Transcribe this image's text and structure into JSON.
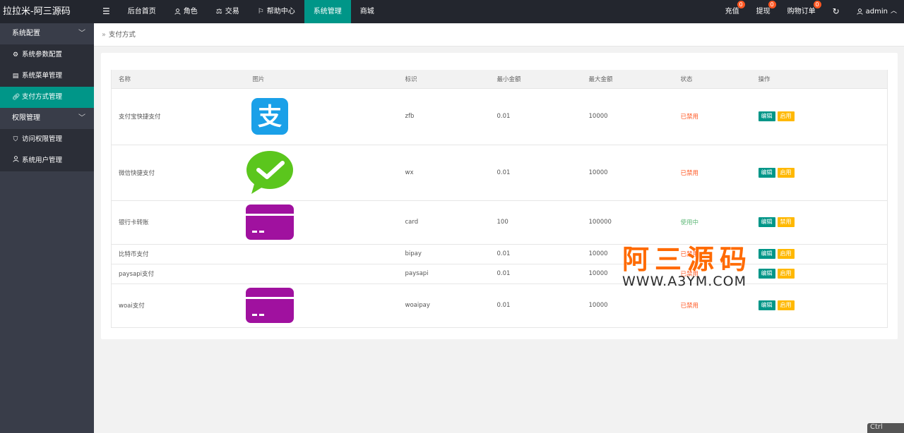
{
  "app": {
    "title": "拉拉米-阿三源码"
  },
  "nav": {
    "toggle_icon": "menu-icon",
    "items": [
      {
        "label": "后台首页",
        "icon": ""
      },
      {
        "label": "角色",
        "icon": "user-icon"
      },
      {
        "label": "交易",
        "icon": "scale-icon"
      },
      {
        "label": "帮助中心",
        "icon": "flag-icon"
      },
      {
        "label": "系统管理",
        "icon": "",
        "active": true
      },
      {
        "label": "商城",
        "icon": ""
      }
    ],
    "right": {
      "recharge": {
        "label": "充值",
        "badge": "0"
      },
      "withdraw": {
        "label": "提现",
        "badge": "0"
      },
      "orders": {
        "label": "购物订单",
        "badge": "0"
      },
      "refresh_icon": "refresh-icon",
      "user": {
        "label": "admin",
        "icon": "user-icon",
        "chevron": "chevron-up-icon"
      }
    }
  },
  "sidebar": {
    "groups": [
      {
        "label": "系统配置",
        "items": [
          {
            "label": "系统参数配置",
            "icon": "gear-icon"
          },
          {
            "label": "系统菜单管理",
            "icon": "window-icon"
          },
          {
            "label": "支付方式管理",
            "icon": "link-icon",
            "active": true
          }
        ]
      },
      {
        "label": "权限管理",
        "items": [
          {
            "label": "访问权限管理",
            "icon": "shield-icon"
          },
          {
            "label": "系统用户管理",
            "icon": "user-icon"
          }
        ]
      }
    ]
  },
  "breadcrumb": {
    "label": "支付方式"
  },
  "table": {
    "headers": [
      "名称",
      "图片",
      "标识",
      "最小金额",
      "最大金额",
      "状态",
      "操作"
    ],
    "rows": [
      {
        "name": "支付宝快捷支付",
        "image": "alipay-logo",
        "code": "zfb",
        "min": "0.01",
        "max": "10000",
        "status": "已禁用",
        "edit": "编辑",
        "toggle": "启用"
      },
      {
        "name": "微信快捷支付",
        "image": "wechat-logo",
        "code": "wx",
        "min": "0.01",
        "max": "10000",
        "status": "已禁用",
        "edit": "编辑",
        "toggle": "启用"
      },
      {
        "name": "银行卡转账",
        "image": "card-logo",
        "code": "card",
        "min": "100",
        "max": "100000",
        "status": "使用中",
        "edit": "编辑",
        "toggle": "禁用"
      },
      {
        "name": "比特币支付",
        "image": "",
        "code": "bipay",
        "min": "0.01",
        "max": "10000",
        "status": "已禁用",
        "edit": "编辑",
        "toggle": "启用"
      },
      {
        "name": "paysapi支付",
        "image": "",
        "code": "paysapi",
        "min": "0.01",
        "max": "10000",
        "status": "已禁用",
        "edit": "编辑",
        "toggle": "启用"
      },
      {
        "name": "woai支付",
        "image": "card-logo",
        "code": "woaipay",
        "min": "0.01",
        "max": "10000",
        "status": "已禁用",
        "edit": "编辑",
        "toggle": "启用"
      }
    ]
  },
  "watermark": {
    "cn": "阿三源码",
    "en": "WWW.A3YM.COM"
  },
  "corner_tip": "Ctrl",
  "colors": {
    "header_bg": "#23262e",
    "sidebar_bg": "#393d49",
    "accent": "#009688",
    "disabled": "#ff5722",
    "enabled": "#5fb878",
    "warn_button": "#ffb800"
  }
}
